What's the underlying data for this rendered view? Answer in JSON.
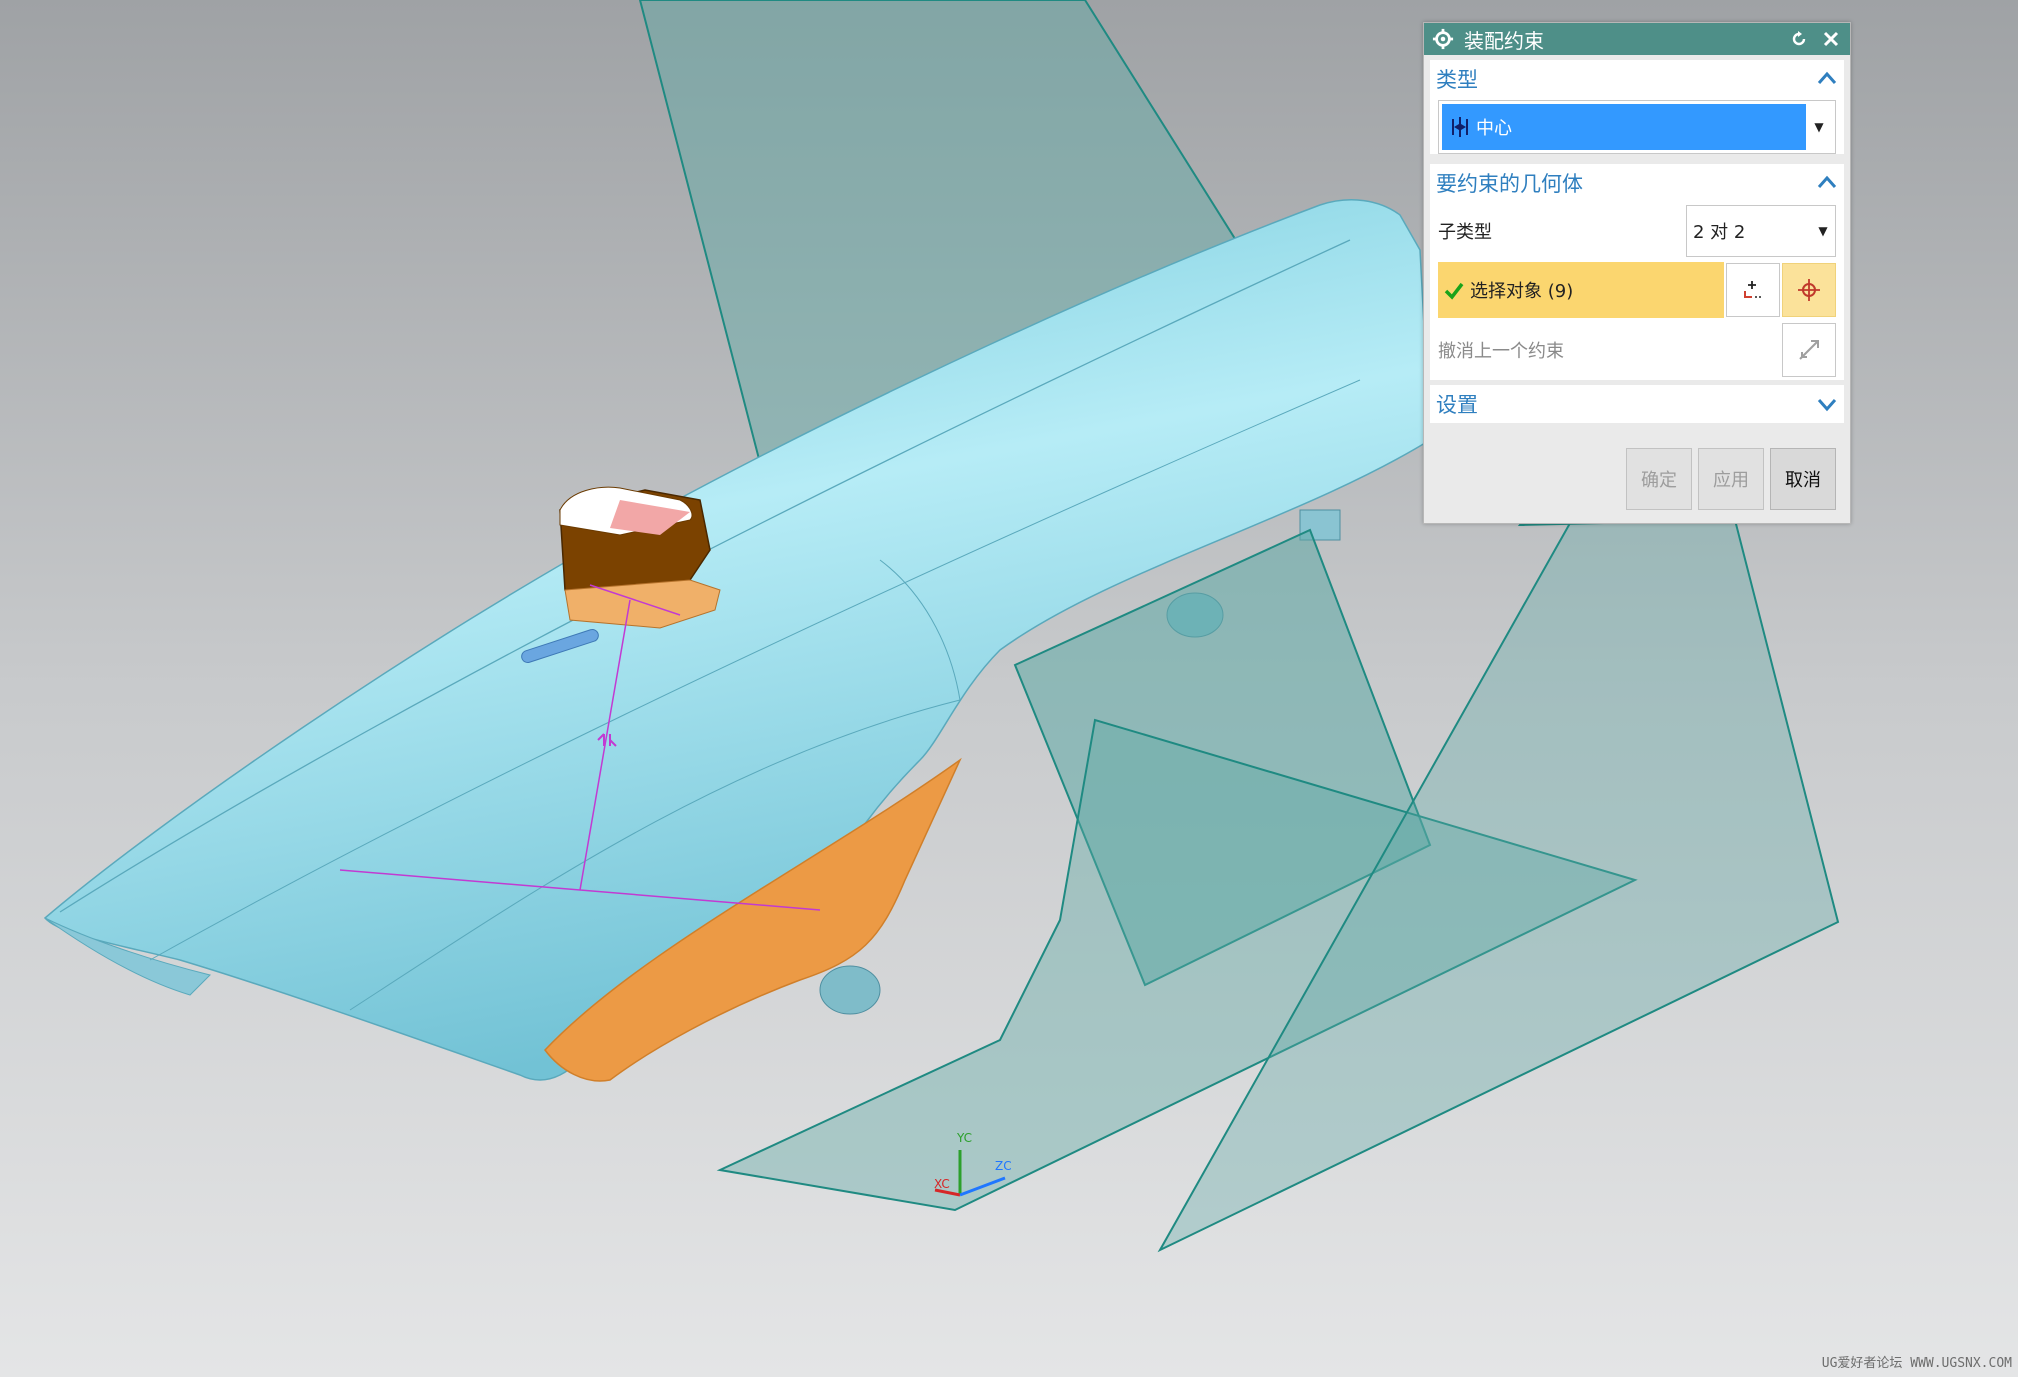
{
  "dialog": {
    "title": "装配约束",
    "sections": {
      "type": {
        "label": "类型",
        "selected": "中心"
      },
      "geometry": {
        "label": "要约束的几何体",
        "subtype_label": "子类型",
        "subtype_value": "2 对 2",
        "select_label": "选择对象 (9)",
        "undo_label": "撤消上一个约束"
      },
      "settings": {
        "label": "设置"
      }
    },
    "buttons": {
      "ok": "确定",
      "apply": "应用",
      "cancel": "取消"
    }
  },
  "triad": {
    "y_label": "YC",
    "x_label": "XC",
    "z_label": "ZC"
  },
  "watermark": "UG爱好者论坛 WWW.UGSNX.COM",
  "colors": {
    "titlebar": "#4e8f88",
    "section_heading": "#2f7fbf",
    "selected_item": "#3399ff",
    "selection_bar": "#fbd66f",
    "part_body": "#8fd4e6",
    "part_orange": "#ec9a45",
    "datum_plane": "#5faaa6"
  }
}
